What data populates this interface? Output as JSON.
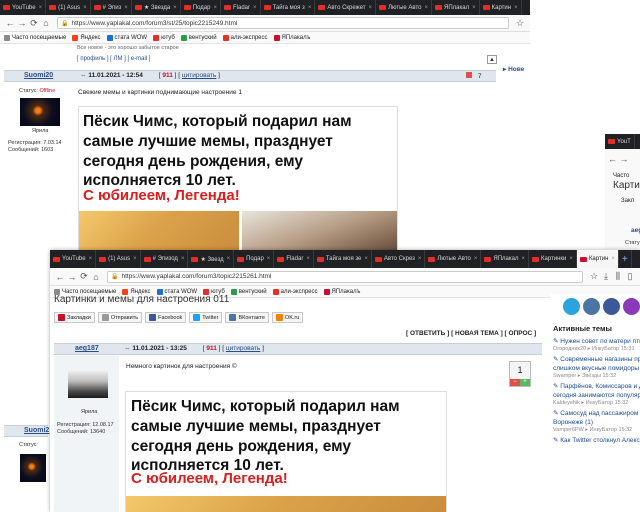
{
  "back_window": {
    "tabs": [
      {
        "label": "YouTube"
      },
      {
        "label": "(1) Asus"
      },
      {
        "label": "# Эпиз"
      },
      {
        "label": "★ Звезда"
      },
      {
        "label": "Подар"
      },
      {
        "label": "Fladar"
      },
      {
        "label": "Тайга моя з"
      },
      {
        "label": "Авто Скрежет"
      },
      {
        "label": "Лютые Авто"
      },
      {
        "label": "ЯПлакал"
      },
      {
        "label": "Картин"
      }
    ],
    "url": "https://www.yaplakal.com/forum3/st/25/topic2215249.html",
    "bookmarks": [
      {
        "label": "Часто посещаемые",
        "color": "#8a8a8a"
      },
      {
        "label": "Яндекс",
        "color": "#fc3f1d"
      },
      {
        "label": "стата WOW",
        "color": "#1d6fd1"
      },
      {
        "label": "ютуб",
        "color": "#e52d27"
      },
      {
        "label": "вентуский",
        "color": "#2b9d48"
      },
      {
        "label": "али-экспресс",
        "color": "#e43225"
      },
      {
        "label": "ЯПлакалъ",
        "color": "#c8102e"
      }
    ],
    "sig_note": "Все новое - это хорошо забытое старое",
    "profile_links": "[ профиль ] [ ЛМ ] [ e-mail ]",
    "post": {
      "username": "Suomi20",
      "date": "11.01.2021 - 12:54",
      "post_id": "911",
      "quote": "цитировать",
      "status_label": "Статус:",
      "status_value": "Offline",
      "rank": "Ярила",
      "reg_label": "Регистрация: 7.03.14",
      "msgs_label": "Сообщений: 1603",
      "text": "Свежие мемы и картинки поднимающие настроение 1",
      "rating": "7"
    },
    "meme_text": "Пёсик Чимс, который подарил нам самые лучшие мемы, празднует сегодня день рождения, ему исполняется 10 лет.",
    "meme_red": "С юбилеем, Легенда!",
    "side_link": "Нове",
    "lower_user": "Suomi2",
    "lower_status": "Статус:"
  },
  "right_window": {
    "tab": "YouT",
    "side_text1": "Часто",
    "side_text2": "Картин",
    "side_text3": "Закл",
    "side_text4": "aeg",
    "side_text5": "Стату"
  },
  "front_window": {
    "tabs": [
      {
        "label": "YouTube"
      },
      {
        "label": "(1) Asus"
      },
      {
        "label": "# Эпизод"
      },
      {
        "label": "★ Звезд"
      },
      {
        "label": "Подар"
      },
      {
        "label": "Fladar"
      },
      {
        "label": "Тайга моя зе"
      },
      {
        "label": "Авто Скрез"
      },
      {
        "label": "Лютые Авто"
      },
      {
        "label": "ЯПлакал"
      },
      {
        "label": "Картинки"
      },
      {
        "label": "Картин",
        "active": true
      }
    ],
    "url": "https://www.yaplakal.com/forum3/topic2215261.html",
    "bookmarks": [
      {
        "label": "Часто посещаемые",
        "color": "#8a8a8a"
      },
      {
        "label": "Яндекс",
        "color": "#fc3f1d"
      },
      {
        "label": "стата WOW",
        "color": "#1d6fd1"
      },
      {
        "label": "ютуб",
        "color": "#e52d27"
      },
      {
        "label": "вентуский",
        "color": "#2b9d48"
      },
      {
        "label": "али-экспресс",
        "color": "#e43225"
      },
      {
        "label": "ЯПлакалъ",
        "color": "#c8102e"
      }
    ],
    "page_title": "Картинки и мемы для настроения 011",
    "share_buttons": [
      {
        "label": "Закладки",
        "color": "#c8102e"
      },
      {
        "label": "Отправить",
        "color": "#9a9a9a"
      },
      {
        "label": "Facebook",
        "color": "#3b5998"
      },
      {
        "label": "Twitter",
        "color": "#1da1f2"
      },
      {
        "label": "ВКонтакте",
        "color": "#4c75a3"
      },
      {
        "label": "OK.ru",
        "color": "#ee8208"
      }
    ],
    "actions": "[ ОТВЕТИТЬ ] [ НОВАЯ ТЕМА ] [ ОПРОС ]",
    "post": {
      "username": "aeg187",
      "date": "11.01.2021 - 13:25",
      "post_id": "911",
      "quote": "цитировать",
      "rank": "Ярила",
      "reg_label": "Регистрация: 12.08.17",
      "msgs_label": "Сообщений: 13640",
      "text": "Немного картинок для настроения ©",
      "rating": "1"
    },
    "meme_text": "Пёсик Чимс, который подарил нам самые лучшие мемы, празднует сегодня день рождения, ему исполняется 10 лет.",
    "meme_red": "С юбилеем, Легенда!"
  },
  "sidebar": {
    "title": "Активные темы",
    "social": [
      {
        "name": "telegram",
        "color": "#2aa3df"
      },
      {
        "name": "vk",
        "color": "#4c75a3"
      },
      {
        "name": "facebook",
        "color": "#3b5998"
      },
      {
        "name": "instagram",
        "color": "#8a3ab9"
      }
    ],
    "topics": [
      {
        "title": "Нужен совет по матери птичника.",
        "count": "(24)",
        "author": "Огородник20",
        "last": "ИнкуБатор",
        "time": "15:31"
      },
      {
        "title": "Современные нагазины продают ни слишком вкусные помидоры",
        "count": "",
        "author": "Swamper",
        "last": "Звёзды",
        "time": "15:32"
      },
      {
        "title": "Парфёнов, Комиссаров и другие: чем сегодня занимаются популяр...",
        "count": "(104)",
        "author": "Kaldeyehik",
        "last": "ИнкуБатор",
        "time": "15:32"
      },
      {
        "title": "Самосуд над пассажиром такси в Воронеже",
        "count": "(1)",
        "author": "Vamper6PW",
        "last": "ИнкуБатор",
        "time": "15:32"
      },
      {
        "title": "Как Twitter столкнул Алексея",
        "count": "",
        "author": "",
        "last": "",
        "time": ""
      }
    ]
  }
}
